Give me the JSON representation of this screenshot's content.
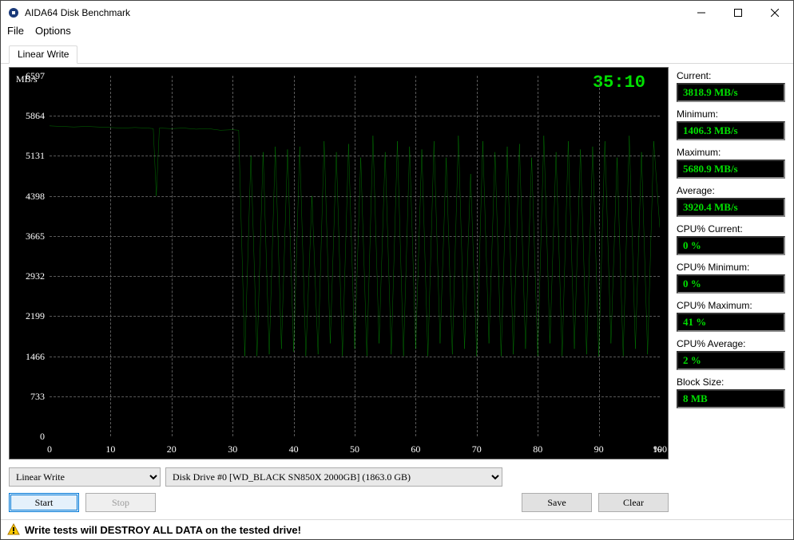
{
  "window": {
    "title": "AIDA64 Disk Benchmark"
  },
  "menu": {
    "file": "File",
    "options": "Options"
  },
  "tab": {
    "label": "Linear Write"
  },
  "chart": {
    "yunit": "MB/s",
    "timer": "35:10",
    "yticks": [
      "6597",
      "5864",
      "5131",
      "4398",
      "3665",
      "2932",
      "2199",
      "1466",
      "733",
      "0"
    ],
    "xticks": [
      "0",
      "10",
      "20",
      "30",
      "40",
      "50",
      "60",
      "70",
      "80",
      "90",
      "100"
    ],
    "xunit": "%"
  },
  "mode": {
    "selected": "Linear Write"
  },
  "drive": {
    "selected": "Disk Drive #0  [WD_BLACK SN850X 2000GB]  (1863.0 GB)"
  },
  "buttons": {
    "start": "Start",
    "stop": "Stop",
    "save": "Save",
    "clear": "Clear"
  },
  "stats": {
    "current_lbl": "Current:",
    "current_val": "3818.9 MB/s",
    "min_lbl": "Minimum:",
    "min_val": "1406.3 MB/s",
    "max_lbl": "Maximum:",
    "max_val": "5680.9 MB/s",
    "avg_lbl": "Average:",
    "avg_val": "3920.4 MB/s",
    "cpucur_lbl": "CPU% Current:",
    "cpucur_val": "0 %",
    "cpumin_lbl": "CPU% Minimum:",
    "cpumin_val": "0 %",
    "cpumax_lbl": "CPU% Maximum:",
    "cpumax_val": "41 %",
    "cpuavg_lbl": "CPU% Average:",
    "cpuavg_val": "2 %",
    "block_lbl": "Block Size:",
    "block_val": "8 MB"
  },
  "footer": {
    "warning": "Write tests will DESTROY ALL DATA on the tested drive!"
  },
  "chart_data": {
    "type": "line",
    "title": "Linear Write",
    "xlabel": "%",
    "ylabel": "MB/s",
    "xlim": [
      0,
      100
    ],
    "ylim": [
      0,
      6597
    ],
    "x": [
      0,
      2,
      4,
      6,
      8,
      10,
      12,
      14,
      16,
      17,
      17.5,
      18,
      20,
      22,
      24,
      26,
      28,
      30,
      31,
      32,
      33,
      34,
      35,
      36,
      37,
      38,
      39,
      40,
      41,
      42,
      43,
      44,
      45,
      46,
      47,
      48,
      49,
      50,
      51,
      52,
      53,
      54,
      55,
      56,
      57,
      58,
      59,
      60,
      61,
      62,
      63,
      64,
      65,
      66,
      67,
      68,
      69,
      70,
      71,
      72,
      73,
      74,
      75,
      76,
      77,
      78,
      79,
      80,
      81,
      82,
      83,
      84,
      85,
      86,
      87,
      88,
      89,
      90,
      91,
      92,
      93,
      94,
      95,
      96,
      97,
      98,
      99,
      100
    ],
    "values": [
      5680,
      5670,
      5660,
      5670,
      5660,
      5650,
      5640,
      5650,
      5640,
      5630,
      4398,
      5640,
      5630,
      5640,
      5620,
      5630,
      5600,
      5610,
      5600,
      1466,
      5131,
      1466,
      5200,
      1500,
      5300,
      1600,
      5250,
      1550,
      5300,
      1466,
      4398,
      1500,
      5400,
      1700,
      5200,
      1466,
      5350,
      1600,
      5100,
      1466,
      5500,
      1700,
      5200,
      1500,
      5400,
      1466,
      5300,
      1600,
      5250,
      1466,
      5400,
      1700,
      5100,
      1500,
      5500,
      1600,
      4800,
      1466,
      5400,
      1700,
      5200,
      1466,
      5300,
      1500,
      5350,
      1600,
      5100,
      1466,
      5500,
      1700,
      5200,
      1466,
      5400,
      1600,
      5250,
      1500,
      5300,
      1466,
      5400,
      1700,
      5100,
      1466,
      5500,
      1600,
      5200,
      1500,
      5400,
      3819
    ]
  }
}
